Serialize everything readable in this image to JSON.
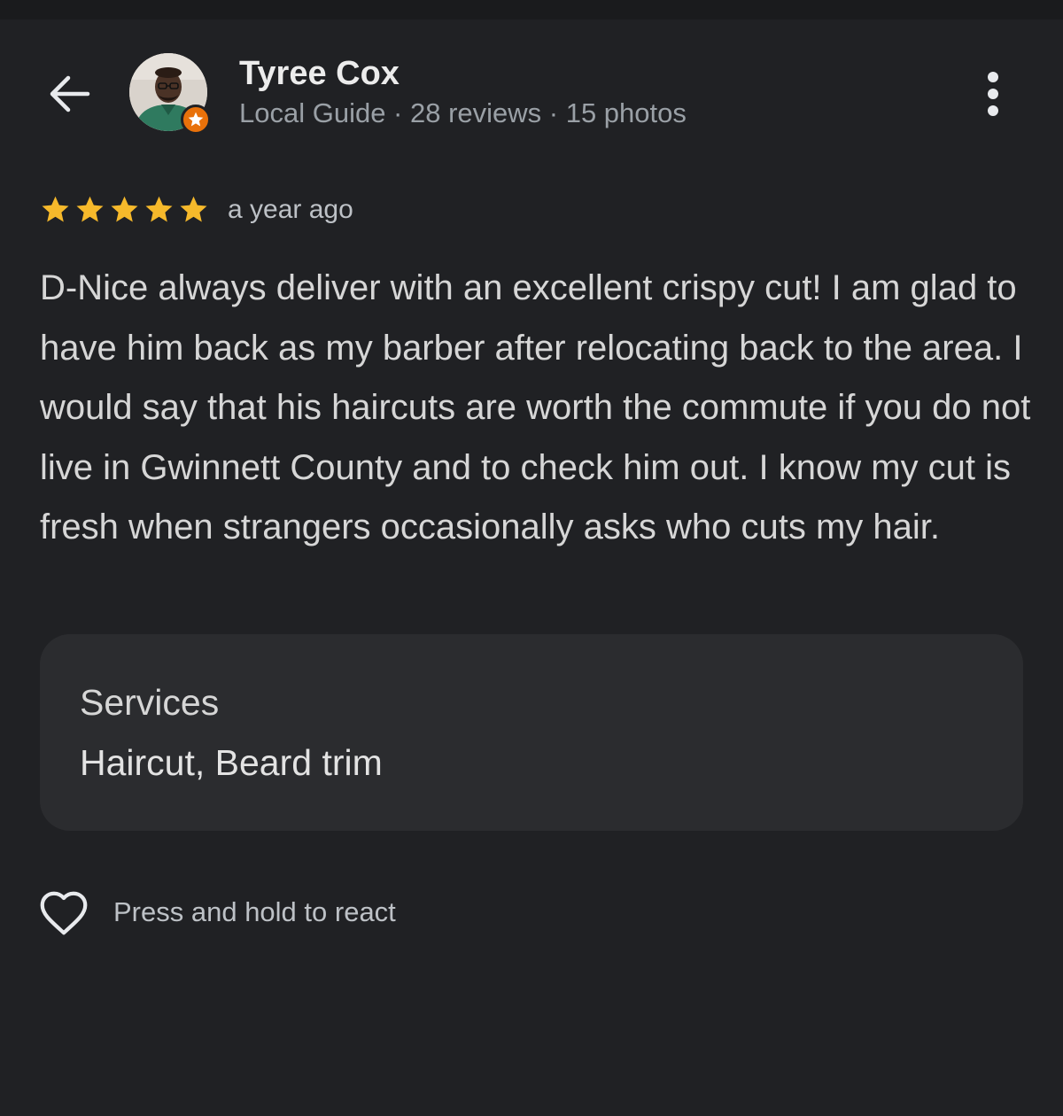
{
  "header": {
    "back_icon": "arrow-left-icon",
    "reviewer_name": "Tyree Cox",
    "reviewer_meta": "Local Guide · 28 reviews · 15 photos",
    "badge_icon": "local-guide-star-icon",
    "badge_color": "#e8710a",
    "more_icon": "more-vertical-icon"
  },
  "review": {
    "rating": 5,
    "rating_max": 5,
    "star_color": "#f6b92b",
    "time_ago": "a year ago",
    "text": "D-Nice always deliver with an excellent crispy cut! I am glad to have him back as my barber after relocating back to the area. I would say that his haircuts are worth the commute if you do not live in Gwinnett County and to check him out. I know my cut is fresh when strangers occasionally asks who cuts my hair."
  },
  "services": {
    "title": "Services",
    "value": "Haircut, Beard trim"
  },
  "reaction": {
    "icon": "heart-outline-icon",
    "label": "Press and hold to react"
  }
}
